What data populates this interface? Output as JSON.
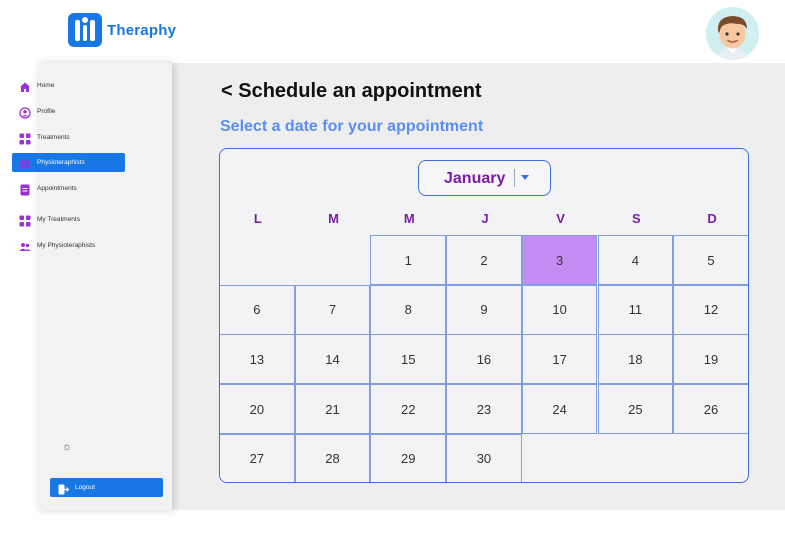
{
  "brand": {
    "name": "Theraphy"
  },
  "sidebar": {
    "items": [
      {
        "label": "Home",
        "icon": "home-icon",
        "active": false
      },
      {
        "label": "Profile",
        "icon": "profile-icon",
        "active": false
      },
      {
        "label": "Treatments",
        "icon": "grid-icon",
        "active": false
      },
      {
        "label": "Physioteraphists",
        "icon": "globe-icon",
        "active": true
      },
      {
        "label": "Appointments",
        "icon": "document-icon",
        "active": false
      },
      {
        "label": "My Treatments",
        "icon": "grid-icon",
        "active": false
      },
      {
        "label": "My Physioteraphists",
        "icon": "people-icon",
        "active": false
      }
    ],
    "logout_label": "Logout"
  },
  "main": {
    "title": "< Schedule an appointment",
    "subtitle": "Select a date for your appointment"
  },
  "calendar": {
    "month": "January",
    "weekdays": [
      "L",
      "M",
      "M",
      "J",
      "V",
      "S",
      "D"
    ],
    "selected_day": "3",
    "weeks": [
      [
        "",
        "",
        "1",
        "2",
        "3",
        "4",
        "5"
      ],
      [
        "6",
        "7",
        "8",
        "9",
        "10",
        "11",
        "12"
      ],
      [
        "13",
        "14",
        "15",
        "16",
        "17",
        "18",
        "19"
      ],
      [
        "20",
        "21",
        "22",
        "23",
        "24",
        "25",
        "26"
      ],
      [
        "27",
        "28",
        "29",
        "30",
        "",
        "",
        ""
      ]
    ]
  },
  "colors": {
    "primary": "#1877e5",
    "accent_purple": "#7a1fa2",
    "selected_day": "#c58cf4",
    "subtitle_blue": "#5b8ef0"
  }
}
